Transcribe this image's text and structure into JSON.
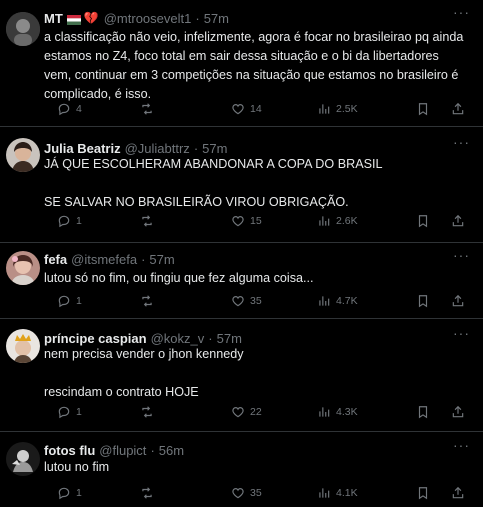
{
  "tweets": [
    {
      "name": "MT",
      "handle": "@mtroosevelt1",
      "time": "57m",
      "separator": "·",
      "paragraphs": [
        "a classificação não veio, infelizmente, agora é focar no brasileirao pq ainda estamos no Z4, foco total em sair dessa situação e o bi da libertadores vem, continuar em 3 competições na situação que estamos no brasileiro é complicado, é isso."
      ],
      "replies": "4",
      "retweets": "",
      "likes": "14",
      "views": "2.5K"
    },
    {
      "name": "Julia Beatriz",
      "handle": "@Juliabttrz",
      "time": "57m",
      "separator": "·",
      "paragraphs": [
        "JÁ QUE ESCOLHERAM ABANDONAR A COPA DO BRASIL",
        "SE SALVAR NO BRASILEIRÃO VIROU OBRIGAÇÃO."
      ],
      "replies": "1",
      "retweets": "",
      "likes": "15",
      "views": "2.6K"
    },
    {
      "name": "fefa",
      "handle": "@itsmefefa",
      "time": "57m",
      "separator": "·",
      "paragraphs": [
        "lutou só no fim, ou fingiu que fez alguma coisa..."
      ],
      "replies": "1",
      "retweets": "",
      "likes": "35",
      "views": "4.7K"
    },
    {
      "name": "príncipe caspian",
      "handle": "@kokz_v",
      "time": "57m",
      "separator": "·",
      "paragraphs": [
        "nem precisa vender o jhon kennedy",
        "rescindam o contrato HOJE"
      ],
      "replies": "1",
      "retweets": "",
      "likes": "22",
      "views": "4.3K"
    },
    {
      "name": "fotos flu",
      "handle": "@flupict",
      "time": "56m",
      "separator": "·",
      "paragraphs": [
        "lutou no fim"
      ],
      "replies": "1",
      "retweets": "",
      "likes": "35",
      "views": "4.1K"
    }
  ],
  "icons": {
    "more": "more-dots-icon",
    "reply": "reply-icon",
    "retweet": "retweet-icon",
    "like": "heart-icon",
    "views": "views-chart-icon",
    "bookmark": "bookmark-icon",
    "share": "share-icon",
    "flag": "hungary-flag-icon",
    "broken_heart": "broken-heart-icon"
  },
  "more_glyph": "···",
  "colors": {
    "background": "#000000",
    "text": "#e7e9ea",
    "muted": "#71767b",
    "divider": "#2f3336"
  }
}
